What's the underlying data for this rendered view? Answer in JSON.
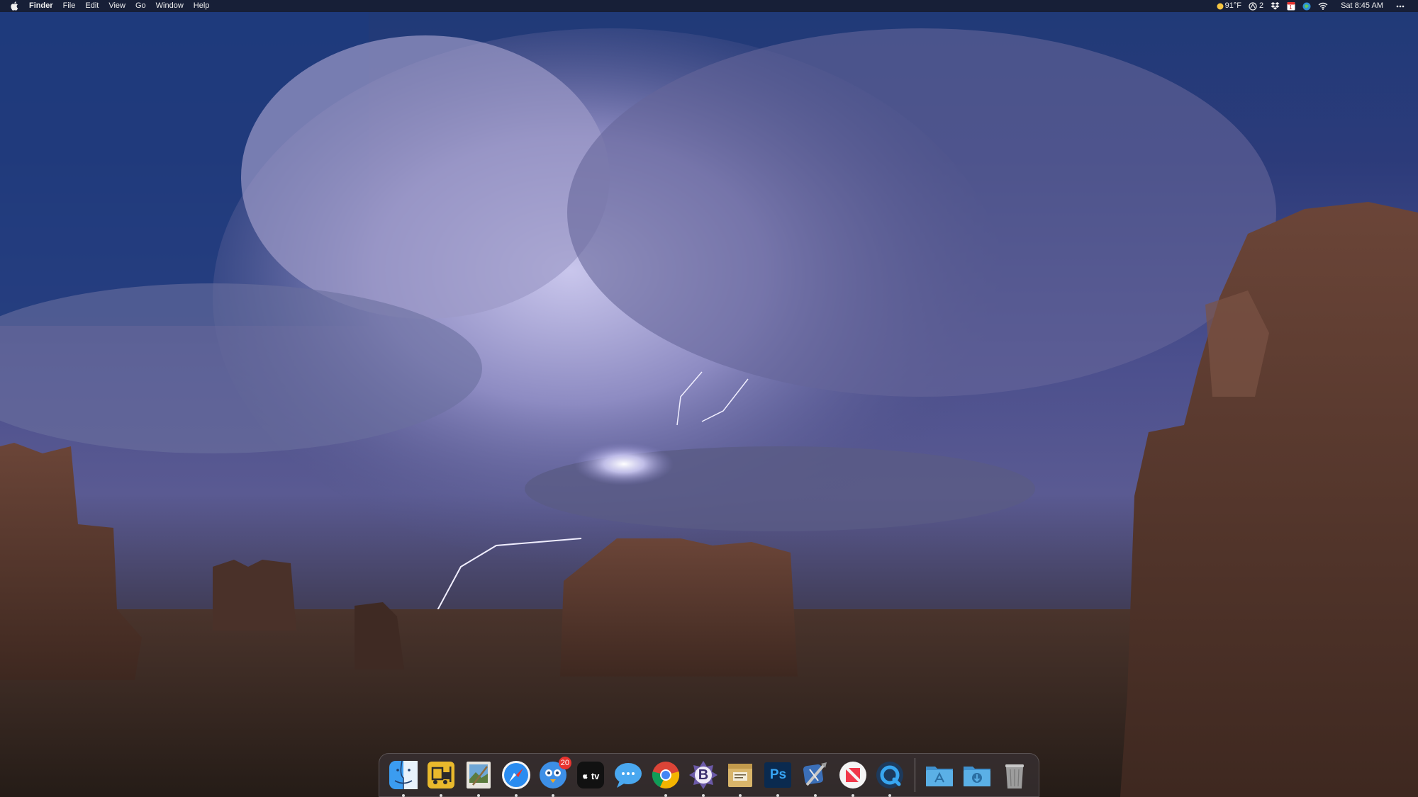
{
  "menubar": {
    "app_name": "Finder",
    "menus": [
      "File",
      "Edit",
      "View",
      "Go",
      "Window",
      "Help"
    ],
    "status": {
      "weather": "91°F",
      "sync_count": "2",
      "calendar_day": "1",
      "clock": "Sat 8:45 AM"
    }
  },
  "dock": {
    "apps": [
      {
        "name": "Finder",
        "icon": "finder-icon",
        "running": true
      },
      {
        "name": "Forklift",
        "icon": "forklift-icon",
        "running": true
      },
      {
        "name": "Preview",
        "icon": "preview-icon",
        "running": true
      },
      {
        "name": "Safari",
        "icon": "safari-icon",
        "running": true
      },
      {
        "name": "Tweetbot",
        "icon": "tweetbot-icon",
        "running": true,
        "badge": "20"
      },
      {
        "name": "TV",
        "icon": "apple-tv-icon",
        "running": false,
        "label": "tv"
      },
      {
        "name": "Messages",
        "icon": "messages-icon",
        "running": false
      },
      {
        "name": "Chrome",
        "icon": "chrome-icon",
        "running": true
      },
      {
        "name": "BBEdit",
        "icon": "bbedit-icon",
        "running": true,
        "label": "B"
      },
      {
        "name": "Archive Utility",
        "icon": "archive-icon",
        "running": true
      },
      {
        "name": "Photoshop",
        "icon": "photoshop-icon",
        "running": true,
        "label": "Ps"
      },
      {
        "name": "Xcode",
        "icon": "xcode-icon",
        "running": true
      },
      {
        "name": "News",
        "icon": "news-icon",
        "running": true
      },
      {
        "name": "QuickTime",
        "icon": "quicktime-icon",
        "running": true
      }
    ],
    "folders": [
      {
        "name": "Applications",
        "icon": "applications-folder-icon"
      },
      {
        "name": "Downloads",
        "icon": "downloads-folder-icon"
      },
      {
        "name": "Trash",
        "icon": "trash-icon"
      }
    ]
  },
  "colors": {
    "menubar_bg": "#161a28",
    "badge_red": "#e8342f",
    "photoshop_blue": "#0a2a4f",
    "folder_blue": "#4fa3d9"
  }
}
